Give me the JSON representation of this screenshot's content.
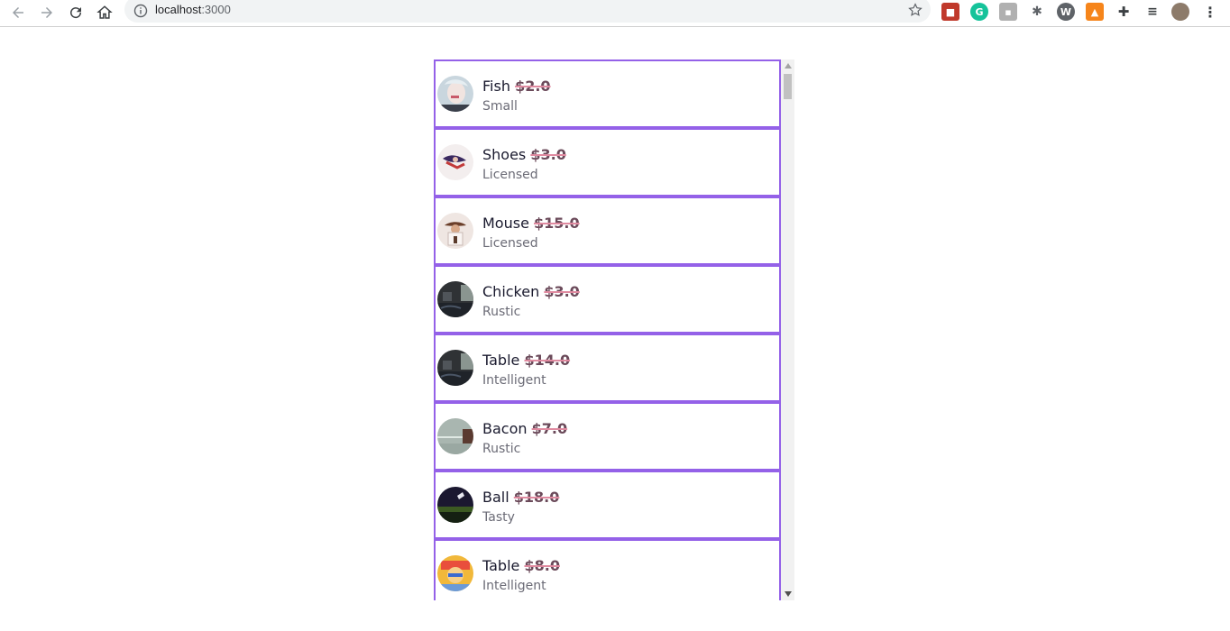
{
  "browser": {
    "url_host": "localhost",
    "url_port": ":3000",
    "extensions": [
      "extension-red-icon",
      "grammarly-icon",
      "extension-gray-icon",
      "bug-icon",
      "wordpress-icon",
      "metamask-icon",
      "puzzle-icon",
      "playlist-icon",
      "profile-avatar",
      "kebab-menu-icon"
    ]
  },
  "accent_color": "#9461e8",
  "products": [
    {
      "name": "Fish",
      "price": "$2.0",
      "material": "Small",
      "avatar": "portrait"
    },
    {
      "name": "Shoes",
      "price": "$3.0",
      "material": "Licensed",
      "avatar": "figure"
    },
    {
      "name": "Mouse",
      "price": "$15.0",
      "material": "Licensed",
      "avatar": "person"
    },
    {
      "name": "Chicken",
      "price": "$3.0",
      "material": "Rustic",
      "avatar": "dark-scene"
    },
    {
      "name": "Table",
      "price": "$14.0",
      "material": "Intelligent",
      "avatar": "dark-scene"
    },
    {
      "name": "Bacon",
      "price": "$7.0",
      "material": "Rustic",
      "avatar": "grey-scene"
    },
    {
      "name": "Ball",
      "price": "$18.0",
      "material": "Tasty",
      "avatar": "night-field"
    },
    {
      "name": "Table",
      "price": "$8.0",
      "material": "Intelligent",
      "avatar": "cartoon"
    }
  ]
}
